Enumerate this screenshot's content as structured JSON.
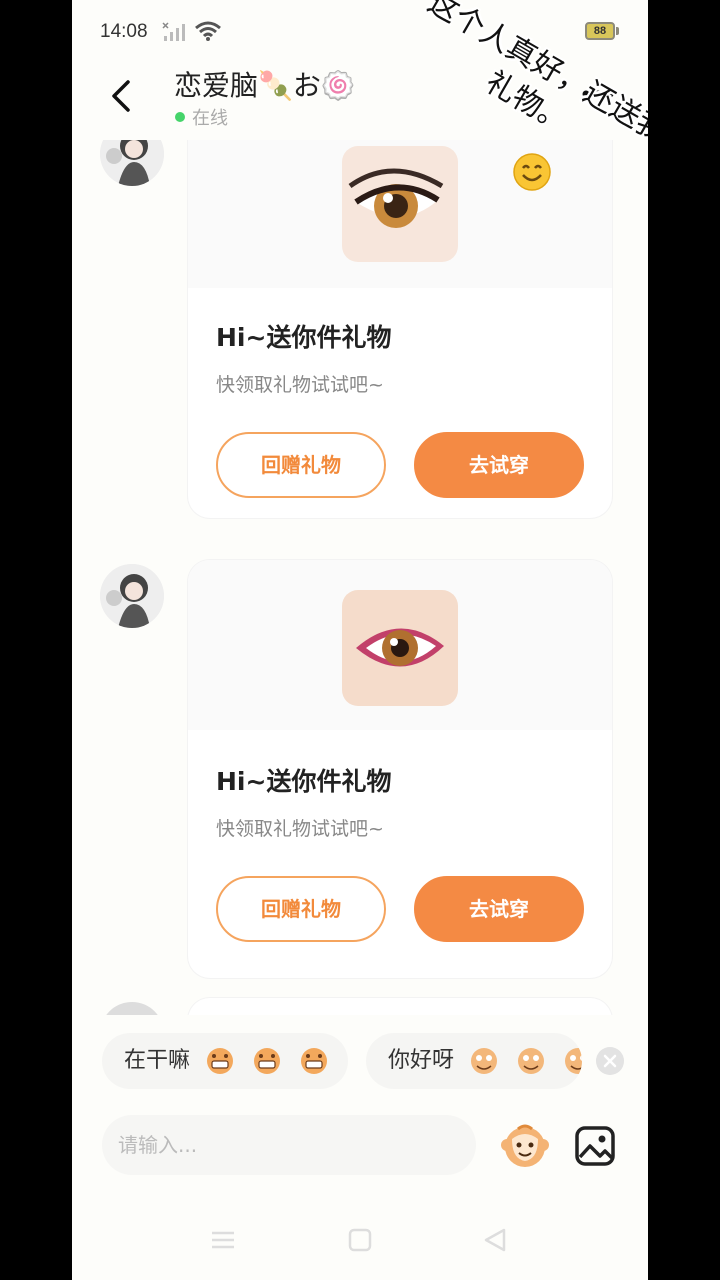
{
  "status_bar": {
    "time": "14:08",
    "battery": "88"
  },
  "header": {
    "title": "恋爱脑🍡お🍥",
    "status": "在线"
  },
  "overlay": {
    "caption": "这个人真好，还送我礼物。"
  },
  "messages": [
    {
      "title": "Hi~送你件礼物",
      "subtitle": "快领取礼物试试吧~",
      "return_gift": "回赠礼物",
      "try_on": "去试穿"
    },
    {
      "title": "Hi~送你件礼物",
      "subtitle": "快领取礼物试试吧~",
      "return_gift": "回赠礼物",
      "try_on": "去试穿"
    }
  ],
  "quick_replies": [
    {
      "label": "在干嘛"
    },
    {
      "label": "你好呀"
    }
  ],
  "composer": {
    "placeholder": "请输入..."
  },
  "colors": {
    "accent": "#f48a44",
    "online": "#45d46a"
  }
}
